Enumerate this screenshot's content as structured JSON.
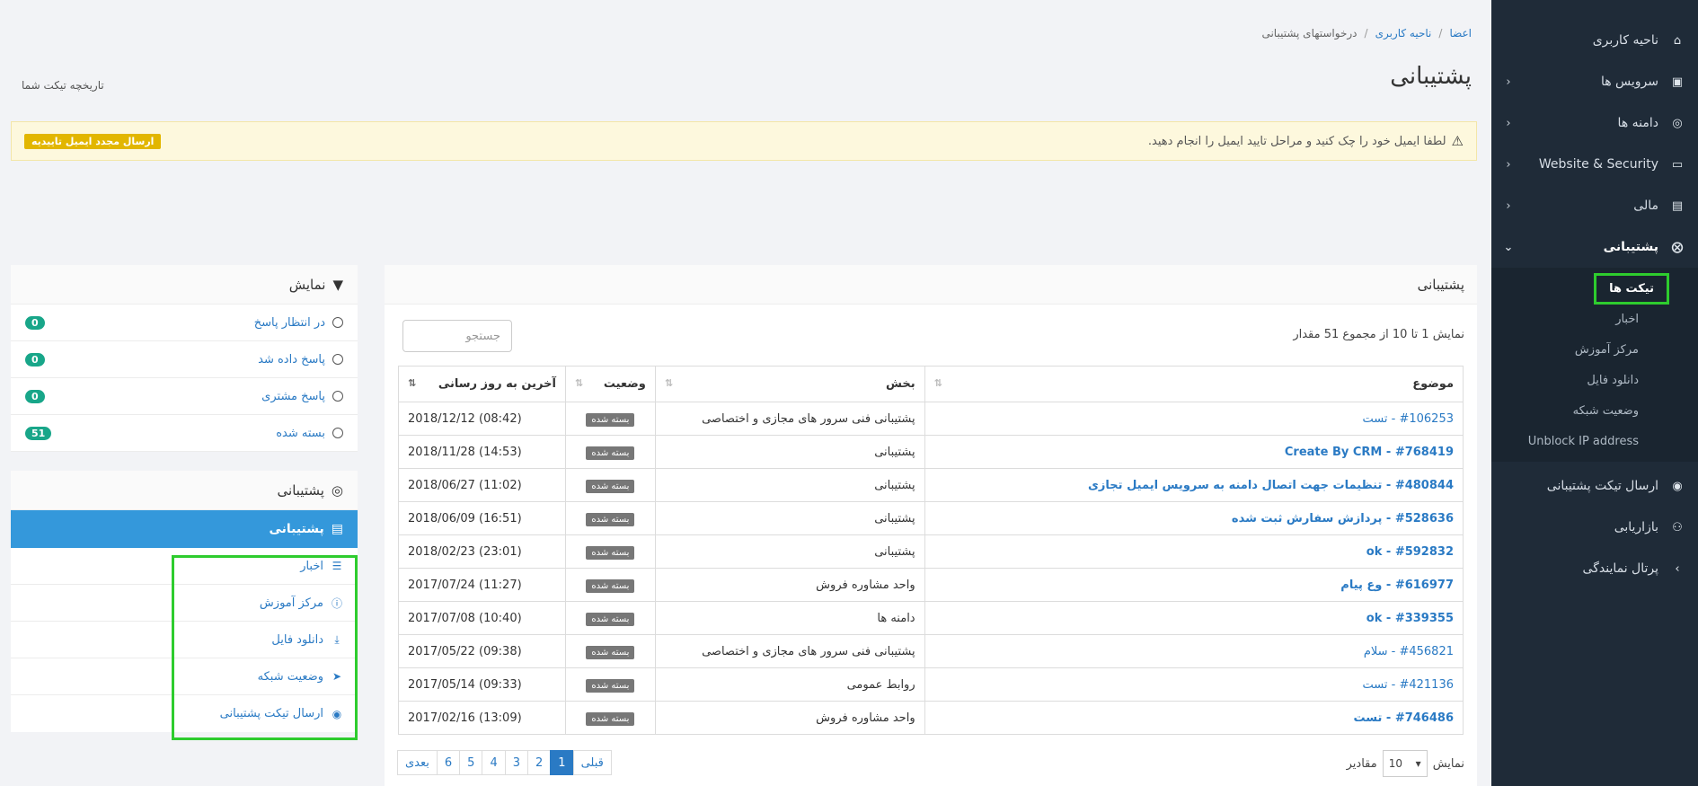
{
  "sidebar": {
    "items": [
      {
        "label": "ناحیه کاربری",
        "icon": "home-icon",
        "chevron": false
      },
      {
        "label": "سرویس ها",
        "icon": "cube-icon",
        "chevron": true
      },
      {
        "label": "دامنه ها",
        "icon": "globe-icon",
        "chevron": true
      },
      {
        "label": "Website & Security",
        "icon": "monitor-icon",
        "chevron": true
      },
      {
        "label": "مالی",
        "icon": "invoice-icon",
        "chevron": true
      },
      {
        "label": "پشتیبانی",
        "icon": "lifebuoy-icon",
        "chevron": true
      }
    ],
    "sub_items": [
      "تیکت ها",
      "اخبار",
      "مرکز آموزش",
      "دانلود فایل",
      "وضعیت شبکه",
      "Unblock IP address"
    ],
    "after_items": [
      {
        "label": "ارسال تیکت پشتیبانی",
        "icon": "comment-icon"
      },
      {
        "label": "بازاریابی",
        "icon": "users-icon"
      },
      {
        "label": "پرتال نمایندگی",
        "icon": "chevron-icon"
      }
    ]
  },
  "breadcrumb": {
    "home": "اعضا",
    "area": "ناحیه کاربری",
    "current": "درخواستهای پشتیبانی"
  },
  "page_title": "پشتیبانی",
  "history_link": "تاریخچه تیکت شما",
  "alert": {
    "message": "لطفا ایمیل خود را چک کنید و مراحل تایید ایمیل را انجام دهید.",
    "button": "ارسال مجدد ایمیل تاییدیه"
  },
  "filter": {
    "title": "نمایش",
    "rows": [
      {
        "label": "در انتظار پاسخ",
        "count": "0"
      },
      {
        "label": "پاسخ داده شد",
        "count": "0"
      },
      {
        "label": "پاسخ مشتری",
        "count": "0"
      },
      {
        "label": "بسته شده",
        "count": "51"
      }
    ]
  },
  "support_panel": {
    "title": "پشتیبانی",
    "active": "پشتیبانی",
    "rows": [
      {
        "label": "اخبار",
        "icon": "list-icon"
      },
      {
        "label": "مرکز آموزش",
        "icon": "info-icon"
      },
      {
        "label": "دانلود فایل",
        "icon": "download-icon"
      },
      {
        "label": "وضعیت شبکه",
        "icon": "rocket-icon"
      },
      {
        "label": "ارسال تیکت پشتیبانی",
        "icon": "comments-icon"
      }
    ]
  },
  "main": {
    "title": "پشتیبانی",
    "info": "نمایش 1 تا 10 از مجموع 51 مقدار",
    "search_placeholder": "جستجو",
    "columns": {
      "subject": "موضوع",
      "dept": "بخش",
      "status": "وضعیت",
      "updated": "آخرین به روز رسانی"
    },
    "rows": [
      {
        "subject": "#106253 - تست",
        "bold": false,
        "dept": "پشتیبانی فنی سرور های مجازی و اختصاصی",
        "status": "بسته شده",
        "date": "2018/12/12 (08:42)"
      },
      {
        "subject": "#768419 - Create By CRM",
        "bold": true,
        "dept": "پشتیبانی",
        "status": "بسته شده",
        "date": "2018/11/28 (14:53)"
      },
      {
        "subject": "#480844 - تنظیمات جهت اتصال دامنه به سرویس ایمیل تجازی",
        "bold": true,
        "dept": "پشتیبانی",
        "status": "بسته شده",
        "date": "2018/06/27 (11:02)"
      },
      {
        "subject": "#528636 - پردازش سفارش ثبت شده",
        "bold": true,
        "dept": "پشتیبانی",
        "status": "بسته شده",
        "date": "2018/06/09 (16:51)"
      },
      {
        "subject": "#592832 - ok",
        "bold": true,
        "dept": "پشتیبانی",
        "status": "بسته شده",
        "date": "2018/02/23 (23:01)"
      },
      {
        "subject": "#616977 - وع پیام",
        "bold": true,
        "dept": "واحد مشاوره فروش",
        "status": "بسته شده",
        "date": "2017/07/24 (11:27)"
      },
      {
        "subject": "#339355 - ok",
        "bold": true,
        "dept": "دامنه ها",
        "status": "بسته شده",
        "date": "2017/07/08 (10:40)"
      },
      {
        "subject": "#456821 - سلام",
        "bold": false,
        "dept": "پشتیبانی فنی سرور های مجازی و اختصاصی",
        "status": "بسته شده",
        "date": "2017/05/22 (09:38)"
      },
      {
        "subject": "#421136 - تست",
        "bold": false,
        "dept": "روابط عمومی",
        "status": "بسته شده",
        "date": "2017/05/14 (09:33)"
      },
      {
        "subject": "#746486 - تست",
        "bold": true,
        "dept": "واحد مشاوره فروش",
        "status": "بسته شده",
        "date": "2017/02/16 (13:09)"
      }
    ],
    "page_length": {
      "label_pre": "نمایش",
      "value": "10",
      "label_post": "مقادیر"
    },
    "pagination": {
      "prev": "قبلی",
      "pages": [
        "1",
        "2",
        "3",
        "4",
        "5",
        "6"
      ],
      "current": "1",
      "next": "بعدی"
    }
  }
}
